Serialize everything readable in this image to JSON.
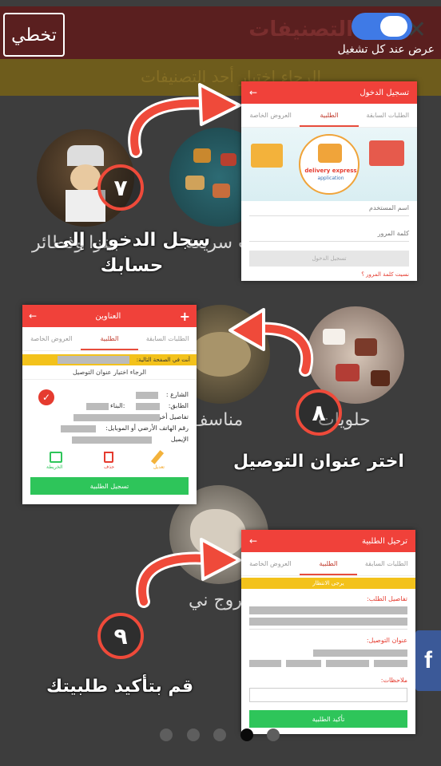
{
  "overlay": {
    "toggle_label": "عرض عند كل تشغيل",
    "skip_label": "تخطي"
  },
  "background_app": {
    "header_title": "التصنيفات",
    "banner_text": "الرجاء اختيار أحد التصنيفات",
    "categories": {
      "c1": "بيتزا وفطائر",
      "c2": "وجبات سريعة",
      "c3": "حلويات",
      "c4": "مناسف",
      "c5": "فروج ني"
    }
  },
  "steps": [
    {
      "number": "٧",
      "caption_line1": "سجل الدخول إلى",
      "caption_line2": "حسابك"
    },
    {
      "number": "٨",
      "caption": "اختر عنوان التوصيل"
    },
    {
      "number": "٩",
      "caption": "قم بتأكيد طلبيتك"
    }
  ],
  "screen_login": {
    "title": "تسجيل الدخول",
    "tabs": [
      "الطلبات السابقة",
      "الطلبية",
      "العروض الخاصة"
    ],
    "logo_line1": "delivery express",
    "logo_line2": "application",
    "username_placeholder": "اسم المستخدم",
    "password_placeholder": "كلمة المرور",
    "login_button": "تسجيل الدخول",
    "forgot_link": "نسيت كلمة المرور ؟"
  },
  "screen_address": {
    "title": "العناوين",
    "tabs": [
      "الطلبات السابقة",
      "الطلبية",
      "العروض الخاصة"
    ],
    "page_notice": "أنت في الصفحة التالية:",
    "choose_address": "الرجاء اختيار عنوان التوصيل",
    "street_label": "الشارع :",
    "floor_label": "الطابق:",
    "building_label": ":البناء",
    "other_details": "تفاصيل أخرى",
    "phone_label": "رقم الهاتف الأرضي أو الموبايل:",
    "email_label": "الإيميل",
    "edit_label": "تعديل",
    "delete_label": "حذف",
    "map_label": "الخريطة",
    "submit_button": "تسجيل الطلبية"
  },
  "screen_confirm": {
    "title": "ترحيل الطلبية",
    "tabs": [
      "الطلبات السابقة",
      "الطلبية",
      "العروض الخاصة"
    ],
    "wait_banner": "يرجى الانتظار",
    "order_details": "تفاصيل الطلب:",
    "delivery_address": "عنوان التوصيل:",
    "notes": "ملاحظات:",
    "confirm_button": "تأكيد الطلبية"
  },
  "pagination": {
    "count": 5,
    "active_index": 3
  },
  "colors": {
    "accent_red": "#f0413a",
    "toggle_blue": "#3f7ae6",
    "facebook_blue": "#3b5998",
    "confirm_green": "#2ec55a"
  },
  "icons": {
    "facebook": "f"
  }
}
